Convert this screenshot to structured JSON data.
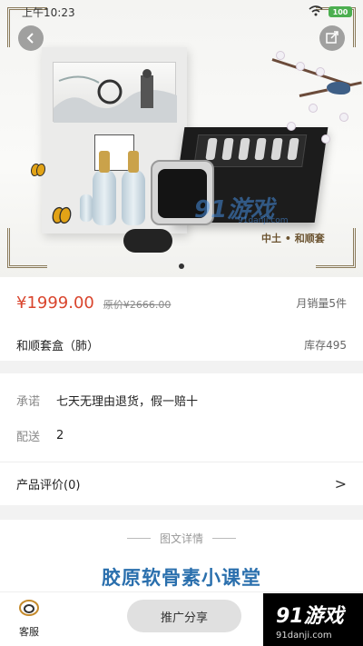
{
  "status_bar": {
    "time": "上午10:23",
    "battery": "100"
  },
  "hero": {
    "brand_text": "中土 • 和顺套",
    "watermark_text": "91游戏",
    "watermark_url": "91danji.com",
    "carousel_page": 1
  },
  "product": {
    "price": "¥1999.00",
    "original_price": "原价¥2666.00",
    "monthly_sales": "月销量5件",
    "name": "和顺套盒（肺）",
    "stock": "库存495"
  },
  "info": {
    "promise_label": "承诺",
    "promise_value": "七天无理由退货，假一赔十",
    "shipping_label": "配送",
    "shipping_value": "2"
  },
  "reviews": {
    "label": "产品评价(0)",
    "chevron": ">"
  },
  "details": {
    "header": "图文详情",
    "course_title": "胶原软骨素小课堂"
  },
  "bottom_bar": {
    "customer_service_label": "客服",
    "promo_button_label": "推广分享",
    "site_badge_main": "91游戏",
    "site_badge_sub": "91danji.com"
  },
  "colors": {
    "price": "#d9452d",
    "course_title": "#2a6fad",
    "promo_button_bg": "#e0e0e0"
  },
  "icons": {
    "back": "back-arrow-icon",
    "share": "share-icon",
    "customer_service": "headset-icon",
    "review_chevron": "chevron-right-icon"
  }
}
